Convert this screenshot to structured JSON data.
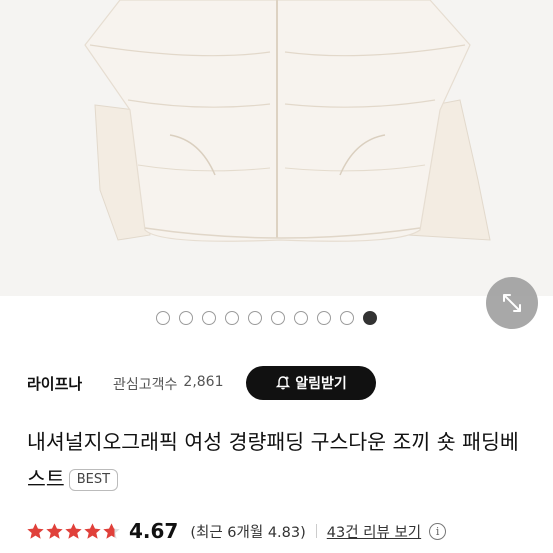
{
  "product_image": {
    "alt": ""
  },
  "gallery": {
    "total": 10,
    "active_index": 9
  },
  "brand": {
    "name": "라이프나",
    "interest_label": "관심고객수",
    "interest_count": "2,861",
    "alarm_button": "알림받기"
  },
  "product": {
    "title": "내셔널지오그래픽 여성 경량패딩 구스다운 조끼 숏 패딩베스트",
    "badge": "BEST"
  },
  "rating": {
    "value": "4.67",
    "stars_filled": 4.67,
    "recent": "(최근 6개월 4.83)",
    "review_link": "43건 리뷰 보기",
    "star_color": "#e0403a"
  },
  "icons": [
    "expand-icon",
    "bell-icon",
    "star-icon",
    "info-icon"
  ]
}
